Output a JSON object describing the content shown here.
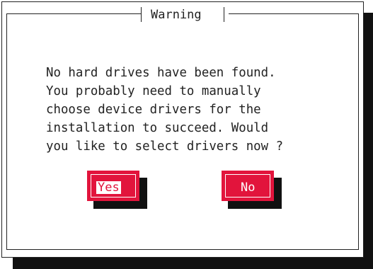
{
  "dialog": {
    "title": "Warning",
    "message_lines": [
      "No hard drives have been found.",
      "You probably need to manually",
      "choose device drivers for the",
      "installation to succeed. Would",
      "you like to select drivers now ?"
    ],
    "buttons": {
      "yes": "Yes",
      "no": "No"
    },
    "focused_button": "yes"
  },
  "colors": {
    "background": "#ffffff",
    "text": "#222222",
    "button": "#e2143c",
    "shadow": "#111111"
  }
}
